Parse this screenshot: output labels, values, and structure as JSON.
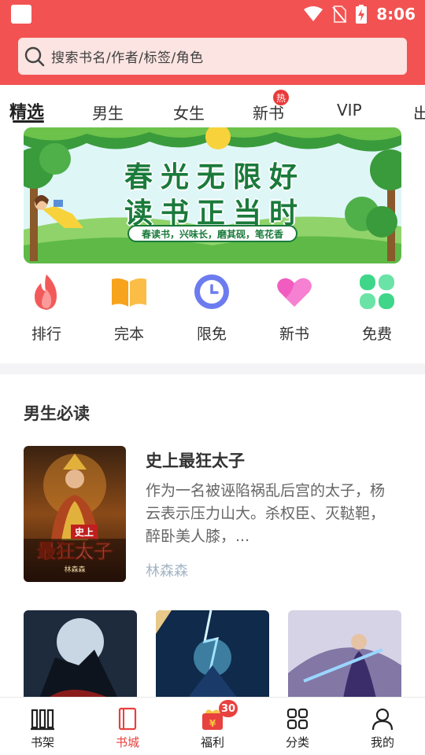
{
  "status_bar": {
    "time": "8:06"
  },
  "search": {
    "placeholder": "搜索书名/作者/标签/角色"
  },
  "tabs": [
    {
      "label": "精选",
      "active": true
    },
    {
      "label": "男生"
    },
    {
      "label": "女生"
    },
    {
      "label": "新书",
      "badge": "热"
    },
    {
      "label": "VIP"
    },
    {
      "label": "出"
    }
  ],
  "banner": {
    "line1": "春光无限好",
    "line2": "读书正当时",
    "slogan": "春读书，兴味长，磨其砚，笔花香"
  },
  "quick_entries": [
    {
      "label": "排行",
      "icon": "flame-icon",
      "color": "#f25a5a"
    },
    {
      "label": "完本",
      "icon": "open-book-icon",
      "color": "#f7a31c"
    },
    {
      "label": "限免",
      "icon": "clock-icon",
      "color": "#6c7cf0"
    },
    {
      "label": "新书",
      "icon": "heart-icon",
      "color": "#f15cc0"
    },
    {
      "label": "免费",
      "icon": "clover-icon",
      "color": "#3fd68a"
    }
  ],
  "section": {
    "title": "男生必读",
    "featured": {
      "title": "史上最狂太子",
      "description": "作为一名被诬陷祸乱后宫的太子，杨云表示压力山大。杀权臣、灭鞑靼，醉卧美人膝，...",
      "author": "林森森",
      "cover_text_top": "史上",
      "cover_text_main": "最狂太子",
      "cover_author": "林森森"
    }
  },
  "bottom_nav": [
    {
      "label": "书架",
      "icon": "bookshelf-icon"
    },
    {
      "label": "书城",
      "icon": "book-city-icon",
      "active": true
    },
    {
      "label": "福利",
      "icon": "gift-icon",
      "badge": "30"
    },
    {
      "label": "分类",
      "icon": "grid-icon"
    },
    {
      "label": "我的",
      "icon": "user-icon"
    }
  ],
  "colors": {
    "brand_red": "#f25352",
    "active_nav": "#e8413e",
    "banner_green": "#1a7a3b"
  }
}
